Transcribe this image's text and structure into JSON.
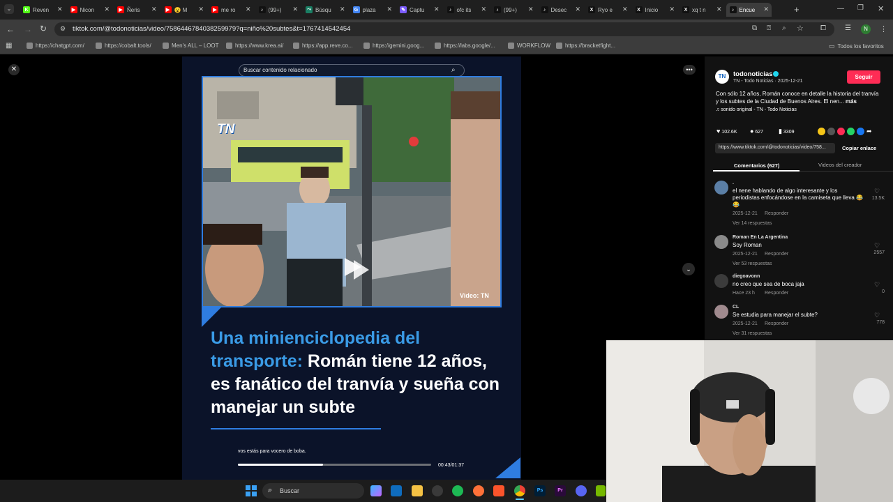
{
  "browser": {
    "tabs": [
      {
        "label": "Reven",
        "fav": "K",
        "color": "#53fc18"
      },
      {
        "label": "Nicon",
        "fav": "▶",
        "color": "#ff0000"
      },
      {
        "label": "Ñeris",
        "fav": "▶",
        "color": "#ff0000"
      },
      {
        "label": "😮 M",
        "fav": "▶",
        "color": "#ff0000"
      },
      {
        "label": "me ro",
        "fav": "▶",
        "color": "#ff0000"
      },
      {
        "label": "(99+)",
        "fav": "♪",
        "color": "#111111"
      },
      {
        "label": "Búsqu",
        "fav": "⤳",
        "color": "#1a7f64"
      },
      {
        "label": "plaza",
        "fav": "G",
        "color": "#4285f4"
      },
      {
        "label": "Captu",
        "fav": "✎",
        "color": "#7b5cff"
      },
      {
        "label": "ofc its",
        "fav": "♪",
        "color": "#111111"
      },
      {
        "label": "(99+)",
        "fav": "♪",
        "color": "#111111"
      },
      {
        "label": "Desec",
        "fav": "♪",
        "color": "#111111"
      },
      {
        "label": "Ryo e",
        "fav": "X",
        "color": "#111111"
      },
      {
        "label": "Inicio",
        "fav": "X",
        "color": "#111111"
      },
      {
        "label": "xq t n",
        "fav": "X",
        "color": "#111111"
      },
      {
        "label": "Encue",
        "fav": "♪",
        "color": "#111111"
      }
    ],
    "url": "tiktok.com/@todonoticias/video/7586446784038259979?q=niño%20subtes&t=1767414542454",
    "bookmarks": [
      "https://chatgpt.com/",
      "https://cobalt.tools/",
      "Men's ALL – LOOT",
      "https://www.krea.ai/",
      "https://app.reve.co...",
      "https://gemini.goog...",
      "https://labs.google/...",
      "WORKFLOW",
      "https://bracketfight..."
    ],
    "favorites_label": "Todos los favoritos",
    "profile_initial": "N"
  },
  "video": {
    "search_placeholder": "Buscar contenido relacionado",
    "headline_highlight": "Una minienciclopedia del transporte:",
    "headline_rest": " Román tiene 12 años, es fanático del tranvía y sueña con manejar un subte",
    "watermark": "Video: TN",
    "tn_logo": "TN",
    "subtitle": "vos estás para vocero de boba.",
    "time": "00:43/01:37",
    "progress": 0.44
  },
  "sidebar": {
    "account": "todonoticias",
    "account_sub": "TN - Todo Noticias · 2025-12-21",
    "follow_label": "Seguir",
    "description": "Con sólo 12 años, Román conoce en detalle la historia del tranvía y los subtes de la Ciudad de Buenos Aires. El nen...",
    "more_label": "más",
    "sound": "sonido original - TN - Todo Noticias",
    "likes": "102.6K",
    "comments_count": "627",
    "saves": "3309",
    "link": "https://www.tiktok.com/@todonoticias/video/758...",
    "copy_label": "Copiar enlace",
    "tab_comments": "Comentarios (627)",
    "tab_creator": "Videos del creador"
  },
  "comments": [
    {
      "user": ".",
      "text": "el nene hablando de algo interesante y los periodistas enfocándose en la camiseta que lleva 😂😂",
      "date": "2025-12-21",
      "reply": "Responder",
      "replies": "Ver 14 respuestas",
      "likes": "13.5K",
      "avatar": "#5b7fa6"
    },
    {
      "user": "Roman En La Argentina",
      "text": "Soy Roman",
      "date": "2025-12-21",
      "reply": "Responder",
      "replies": "Ver 53 respuestas",
      "likes": "2557",
      "avatar": "#8a8a8a"
    },
    {
      "user": "diegoavonn",
      "text": "no creo que sea de boca jaja",
      "date": "Hace 23 h",
      "reply": "Responder",
      "replies": "",
      "likes": "0",
      "avatar": "#3b3b3b"
    },
    {
      "user": "CL",
      "text": "Se estudia para manejar el subte?",
      "date": "2025-12-21",
      "reply": "Responder",
      "replies": "Ver 31 respuestas",
      "likes": "778",
      "avatar": "#a08a8e"
    }
  ],
  "taskbar": {
    "search_label": "Buscar"
  }
}
